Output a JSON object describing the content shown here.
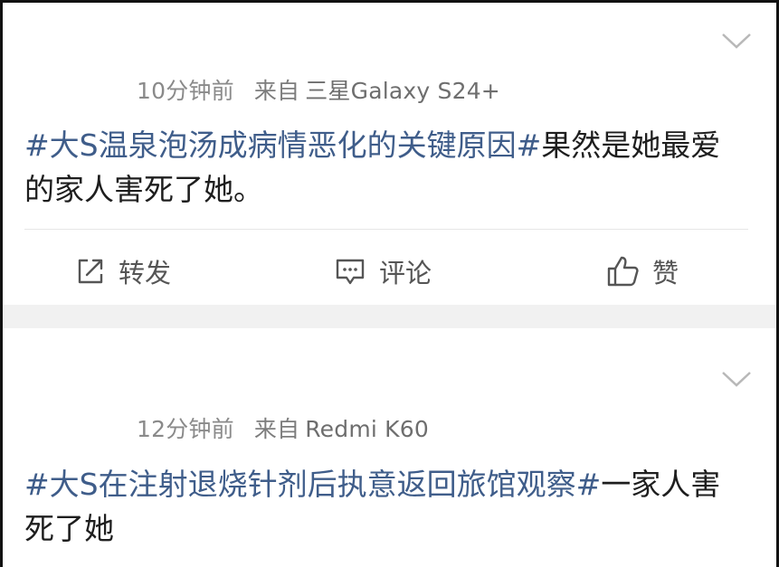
{
  "posts": [
    {
      "time": "10分钟前",
      "source_label": "来自",
      "device": "三星Galaxy S24+",
      "hashtag": "#大S温泉泡汤成病情恶化的关键原因#",
      "text": "果然是她最爱的家人害死了她。",
      "actions": {
        "repost": "转发",
        "comment": "评论",
        "like": "赞"
      }
    },
    {
      "time": "12分钟前",
      "source_label": "来自",
      "device": "Redmi K60",
      "hashtag": "#大S在注射退烧针剂后执意返回旅馆观察#",
      "text": "一家人害死了她"
    }
  ],
  "icons": {
    "collapse": "chevron-down-icon",
    "repost": "share-icon",
    "comment": "comment-icon",
    "like": "thumbs-up-icon"
  },
  "colors": {
    "hashtag": "#3f5d8a",
    "meta": "#8a8a8a",
    "separator": "#f1f1f1"
  }
}
